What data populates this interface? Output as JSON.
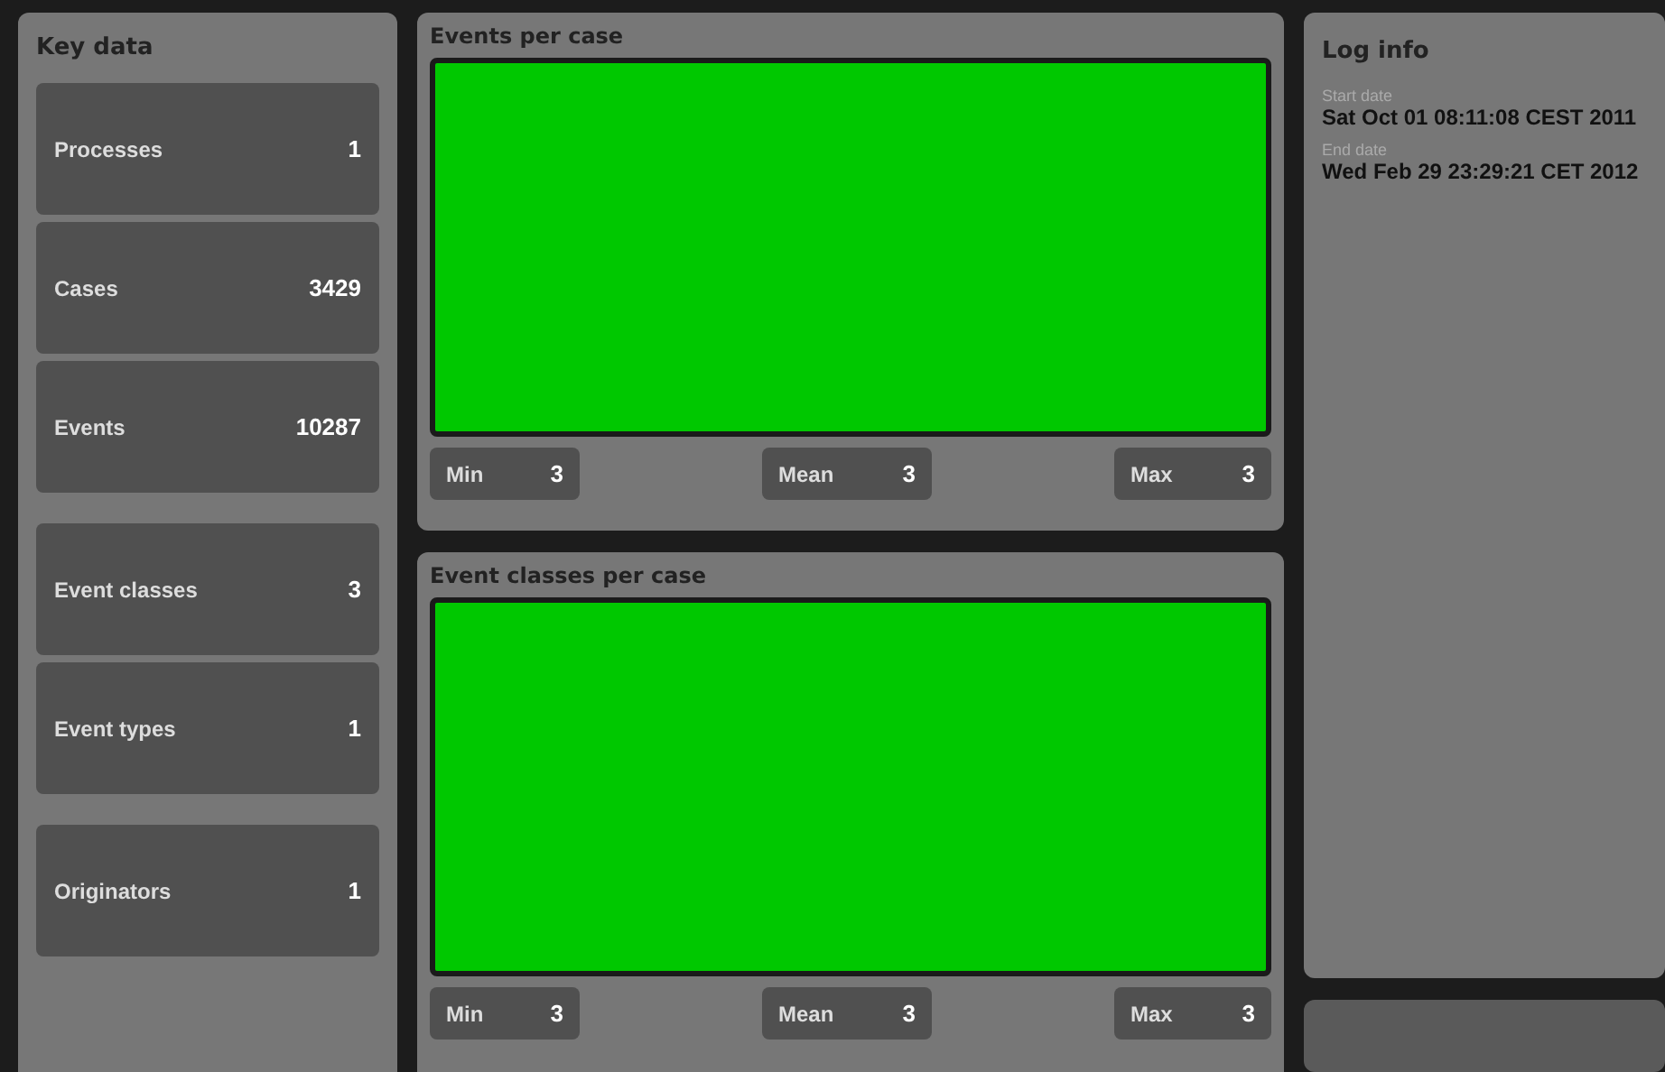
{
  "key_data": {
    "title": "Key data",
    "groups": [
      [
        {
          "label": "Processes",
          "value": "1"
        },
        {
          "label": "Cases",
          "value": "3429"
        },
        {
          "label": "Events",
          "value": "10287"
        }
      ],
      [
        {
          "label": "Event classes",
          "value": "3"
        },
        {
          "label": "Event types",
          "value": "1"
        }
      ],
      [
        {
          "label": "Originators",
          "value": "1"
        }
      ]
    ]
  },
  "charts": [
    {
      "title": "Events per case",
      "stats": [
        {
          "label": "Min",
          "value": "3"
        },
        {
          "label": "Mean",
          "value": "3"
        },
        {
          "label": "Max",
          "value": "3"
        }
      ]
    },
    {
      "title": "Event classes per case",
      "stats": [
        {
          "label": "Min",
          "value": "3"
        },
        {
          "label": "Mean",
          "value": "3"
        },
        {
          "label": "Max",
          "value": "3"
        }
      ]
    }
  ],
  "log_info": {
    "title": "Log info",
    "fields": [
      {
        "label": "Start date",
        "value": "Sat Oct 01 08:11:08 CEST 2011"
      },
      {
        "label": "End date",
        "value": "Wed Feb 29 23:29:21 CET 2012"
      }
    ]
  }
}
